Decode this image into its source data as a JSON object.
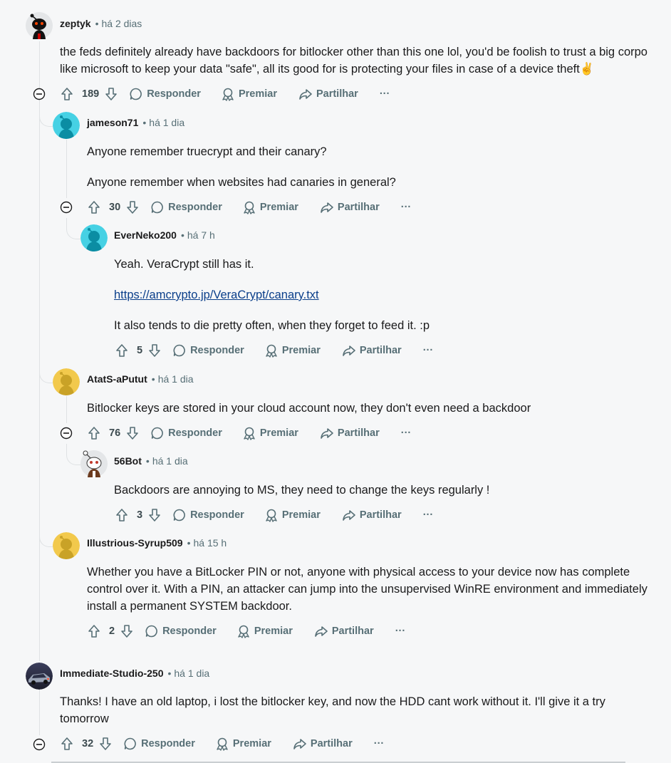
{
  "labels": {
    "reply": "Responder",
    "award": "Premiar",
    "share": "Partilhar",
    "more": "···"
  },
  "comments": [
    {
      "user": "zeptyk",
      "time": "há 2 dias",
      "body": [
        "the feds definitely already have backdoors for bitlocker other than this one lol, you'd be foolish to trust a big corpo like microsoft to keep your data \"safe\", all its good for is protecting your files in case of a device theft✌️"
      ],
      "score": "189"
    },
    {
      "user": "jameson71",
      "time": "há 1 dia",
      "body": [
        "Anyone remember truecrypt and their canary?",
        "Anyone remember when websites had canaries in general?"
      ],
      "score": "30"
    },
    {
      "user": "EverNeko200",
      "time": "há 7 h",
      "body": [
        "Yeah. VeraCrypt still has it.",
        "https://amcrypto.jp/VeraCrypt/canary.txt",
        "It also tends to die pretty often, when they forget to feed it. :p"
      ],
      "score": "5"
    },
    {
      "user": "AtatS-aPutut",
      "time": "há 1 dia",
      "body": [
        "Bitlocker keys are stored in your cloud account now, they don't even need a backdoor"
      ],
      "score": "76"
    },
    {
      "user": "56Bot",
      "time": "há 1 dia",
      "body": [
        "Backdoors are annoying to MS, they need to change the keys regularly !"
      ],
      "score": "3"
    },
    {
      "user": "Illustrious-Syrup509",
      "time": "há 15 h",
      "body": [
        "Whether you have a BitLocker PIN or not, anyone with physical access to your device now has complete control over it. With a PIN, an attacker can jump into the unsupervised WinRE environment and immediately install a permanent SYSTEM backdoor."
      ],
      "score": "2"
    },
    {
      "user": "Immediate-Studio-250",
      "time": "há 1 dia",
      "body": [
        "Thanks! I have an old laptop, i lost the bitlocker key, and now the HDD cant work without it. I'll give it a try tomorrow"
      ],
      "score": "32"
    }
  ]
}
